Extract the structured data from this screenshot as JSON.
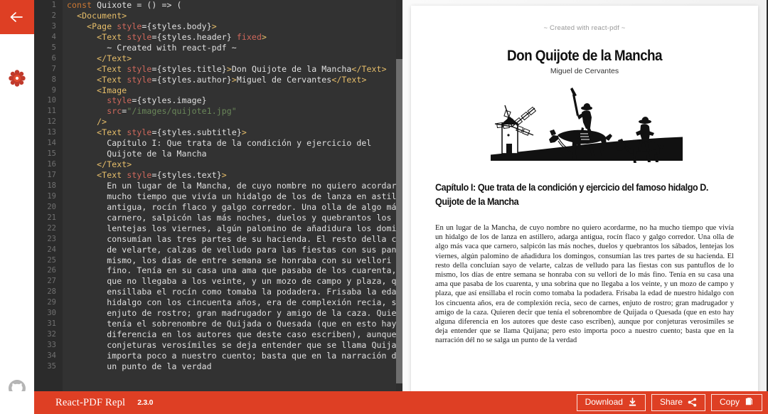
{
  "app": {
    "name": "React-PDF Repl",
    "version": "2.3.0",
    "brand_color": "#DE3F24"
  },
  "rail": {
    "back_label": "Back",
    "back_icon": "arrow-left-icon",
    "settings_icon": "gear-icon",
    "github_icon": "github-icon"
  },
  "editor": {
    "language": "jsx",
    "first_line": 1,
    "last_line": 35,
    "scrollbar": {
      "thumb_top_pct": 15,
      "thumb_height_pct": 83
    },
    "lines": [
      {
        "n": 1,
        "tokens": [
          {
            "t": "const ",
            "c": "kw"
          },
          {
            "t": "Quixote ",
            "c": "plain"
          },
          {
            "t": "= () => (",
            "c": "plain"
          }
        ]
      },
      {
        "n": 2,
        "tokens": [
          {
            "t": "  ",
            "c": "plain"
          },
          {
            "t": "<Document>",
            "c": "tag"
          }
        ]
      },
      {
        "n": 3,
        "tokens": [
          {
            "t": "    ",
            "c": "plain"
          },
          {
            "t": "<Page ",
            "c": "tag"
          },
          {
            "t": "style",
            "c": "prop"
          },
          {
            "t": "=",
            "c": "punc"
          },
          {
            "t": "{styles.body}",
            "c": "plain"
          },
          {
            "t": ">",
            "c": "tag"
          }
        ]
      },
      {
        "n": 4,
        "tokens": [
          {
            "t": "      ",
            "c": "plain"
          },
          {
            "t": "<Text ",
            "c": "tag"
          },
          {
            "t": "style",
            "c": "prop"
          },
          {
            "t": "=",
            "c": "punc"
          },
          {
            "t": "{styles.header} ",
            "c": "plain"
          },
          {
            "t": "fixed",
            "c": "prop"
          },
          {
            "t": ">",
            "c": "tag"
          }
        ]
      },
      {
        "n": 5,
        "tokens": [
          {
            "t": "        ~ Created with react-pdf ~",
            "c": "plain"
          }
        ]
      },
      {
        "n": 6,
        "tokens": [
          {
            "t": "      ",
            "c": "plain"
          },
          {
            "t": "</Text>",
            "c": "tag"
          }
        ]
      },
      {
        "n": 7,
        "tokens": [
          {
            "t": "      ",
            "c": "plain"
          },
          {
            "t": "<Text ",
            "c": "tag"
          },
          {
            "t": "style",
            "c": "prop"
          },
          {
            "t": "=",
            "c": "punc"
          },
          {
            "t": "{styles.title}",
            "c": "plain"
          },
          {
            "t": ">",
            "c": "tag"
          },
          {
            "t": "Don Quijote de la Mancha",
            "c": "plain"
          },
          {
            "t": "</Text>",
            "c": "tag"
          }
        ]
      },
      {
        "n": 8,
        "tokens": [
          {
            "t": "      ",
            "c": "plain"
          },
          {
            "t": "<Text ",
            "c": "tag"
          },
          {
            "t": "style",
            "c": "prop"
          },
          {
            "t": "=",
            "c": "punc"
          },
          {
            "t": "{styles.author}",
            "c": "plain"
          },
          {
            "t": ">",
            "c": "tag"
          },
          {
            "t": "Miguel de Cervantes",
            "c": "plain"
          },
          {
            "t": "</Text>",
            "c": "tag"
          }
        ]
      },
      {
        "n": 9,
        "tokens": [
          {
            "t": "      ",
            "c": "plain"
          },
          {
            "t": "<Image",
            "c": "tag"
          }
        ]
      },
      {
        "n": 10,
        "tokens": [
          {
            "t": "        ",
            "c": "plain"
          },
          {
            "t": "style",
            "c": "prop"
          },
          {
            "t": "=",
            "c": "punc"
          },
          {
            "t": "{styles.image}",
            "c": "plain"
          }
        ]
      },
      {
        "n": 11,
        "tokens": [
          {
            "t": "        ",
            "c": "plain"
          },
          {
            "t": "src",
            "c": "prop"
          },
          {
            "t": "=",
            "c": "punc"
          },
          {
            "t": "\"/images/quijote1.jpg\"",
            "c": "str"
          }
        ]
      },
      {
        "n": 12,
        "tokens": [
          {
            "t": "      ",
            "c": "plain"
          },
          {
            "t": "/>",
            "c": "tag"
          }
        ]
      },
      {
        "n": 13,
        "tokens": [
          {
            "t": "      ",
            "c": "plain"
          },
          {
            "t": "<Text ",
            "c": "tag"
          },
          {
            "t": "style",
            "c": "prop"
          },
          {
            "t": "=",
            "c": "punc"
          },
          {
            "t": "{styles.subtitle}",
            "c": "plain"
          },
          {
            "t": ">",
            "c": "tag"
          }
        ]
      },
      {
        "n": 14,
        "tokens": [
          {
            "t": "        Capítulo I: Que trata de la condición y ejercicio del",
            "c": "plain"
          }
        ]
      },
      {
        "n": 15,
        "tokens": [
          {
            "t": "        Quijote de la Mancha",
            "c": "plain"
          }
        ]
      },
      {
        "n": 16,
        "tokens": [
          {
            "t": "      ",
            "c": "plain"
          },
          {
            "t": "</Text>",
            "c": "tag"
          }
        ]
      },
      {
        "n": 17,
        "tokens": [
          {
            "t": "      ",
            "c": "plain"
          },
          {
            "t": "<Text ",
            "c": "tag"
          },
          {
            "t": "style",
            "c": "prop"
          },
          {
            "t": "=",
            "c": "punc"
          },
          {
            "t": "{styles.text}",
            "c": "plain"
          },
          {
            "t": ">",
            "c": "tag"
          }
        ]
      },
      {
        "n": 18,
        "tokens": [
          {
            "t": "        En un lugar de la Mancha, de cuyo nombre no quiero acordarme",
            "c": "plain"
          }
        ]
      },
      {
        "n": 19,
        "tokens": [
          {
            "t": "        mucho tiempo que vivía un hidalgo de los de lanza en astille",
            "c": "plain"
          }
        ]
      },
      {
        "n": 20,
        "tokens": [
          {
            "t": "        antigua, rocín flaco y galgo corredor. Una olla de algo más",
            "c": "plain"
          }
        ]
      },
      {
        "n": 21,
        "tokens": [
          {
            "t": "        carnero, salpicón las más noches, duelos y quebrantos los sá",
            "c": "plain"
          }
        ]
      },
      {
        "n": 22,
        "tokens": [
          {
            "t": "        lentejas los viernes, algún palomino de añadidura los doming",
            "c": "plain"
          }
        ]
      },
      {
        "n": 23,
        "tokens": [
          {
            "t": "        consumían las tres partes de su hacienda. El resto della con",
            "c": "plain"
          }
        ]
      },
      {
        "n": 24,
        "tokens": [
          {
            "t": "        de velarte, calzas de velludo para las fiestas con sus pantu",
            "c": "plain"
          }
        ]
      },
      {
        "n": 25,
        "tokens": [
          {
            "t": "        mismo, los días de entre semana se honraba con su vellori de",
            "c": "plain"
          }
        ]
      },
      {
        "n": 26,
        "tokens": [
          {
            "t": "        fino. Tenía en su casa una ama que pasaba de los cuarenta, y",
            "c": "plain"
          }
        ]
      },
      {
        "n": 27,
        "tokens": [
          {
            "t": "        que no llegaba a los veinte, y un mozo de campo y plaza, que",
            "c": "plain"
          }
        ]
      },
      {
        "n": 28,
        "tokens": [
          {
            "t": "        ensillaba el rocín como tomaba la podadera. Frisaba la edad",
            "c": "plain"
          }
        ]
      },
      {
        "n": 29,
        "tokens": [
          {
            "t": "        hidalgo con los cincuenta años, era de complexión recia, sec",
            "c": "plain"
          }
        ]
      },
      {
        "n": 30,
        "tokens": [
          {
            "t": "        enjuto de rostro; gran madrugador y amigo de la caza. Quiere",
            "c": "plain"
          }
        ]
      },
      {
        "n": 31,
        "tokens": [
          {
            "t": "        tenía el sobrenombre de Quijada o Quesada (que en esto hay a",
            "c": "plain"
          }
        ]
      },
      {
        "n": 32,
        "tokens": [
          {
            "t": "        diferencia en los autores que deste caso escriben), aunque p",
            "c": "plain"
          }
        ]
      },
      {
        "n": 33,
        "tokens": [
          {
            "t": "        conjeturas verosímiles se deja entender que se llama Quijana",
            "c": "plain"
          }
        ]
      },
      {
        "n": 34,
        "tokens": [
          {
            "t": "        importa poco a nuestro cuento; basta que en la narración dél",
            "c": "plain"
          }
        ]
      },
      {
        "n": 35,
        "tokens": [
          {
            "t": "        un punto de la verdad",
            "c": "plain"
          }
        ]
      }
    ]
  },
  "preview": {
    "document": {
      "header": "~ Created with react-pdf ~",
      "title": "Don Quijote de la Mancha",
      "author": "Miguel de Cervantes",
      "image_alt": "don-quijote-windmill-illustration",
      "subtitle": "Capítulo I: Que trata de la condición y ejercicio del famoso hidalgo D. Quijote de la Mancha",
      "body": "En un lugar de la Mancha, de cuyo nombre no quiero acordarme, no ha mucho tiempo que vivía un hidalgo de los de lanza en astillero, adarga antigua, rocín flaco y galgo corredor. Una olla de algo más vaca que carnero, salpicón las más noches, duelos y quebrantos los sábados, lentejas los viernes, algún palomino de añadidura los domingos, consumían las tres partes de su hacienda. El resto della concluían sayo de velarte, calzas de velludo para las fiestas con sus pantuflos de lo mismo, los días de entre semana se honraba con su vellori de lo más fino. Tenía en su casa una ama que pasaba de los cuarenta, y una sobrina que no llegaba a los veinte, y un mozo de campo y plaza, que así ensillaba el rocín como tomaba la podadera. Frisaba la edad de nuestro hidalgo con los cincuenta años, era de complexión recia, seco de carnes, enjuto de rostro; gran madrugador y amigo de la caza. Quieren decir que tenía el sobrenombre de Quijada o Quesada (que en esto hay alguna diferencia en los autores que deste caso escriben), aunque por conjeturas verosímiles se deja entender que se llama Quijana; pero esto importa poco a nuestro cuento; basta que en la narración dél no se salga un punto de la verdad"
    }
  },
  "footer": {
    "buttons": [
      {
        "label": "Download",
        "icon": "download-icon"
      },
      {
        "label": "Share",
        "icon": "share-icon"
      },
      {
        "label": "Copy",
        "icon": "copy-icon"
      }
    ]
  }
}
